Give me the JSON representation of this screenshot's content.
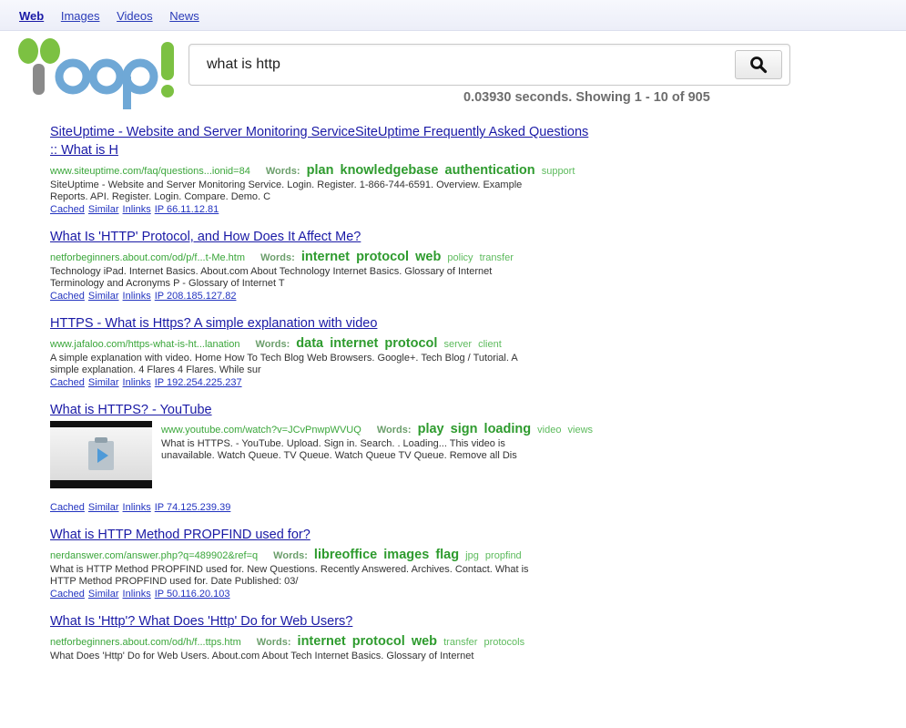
{
  "nav": {
    "tabs": [
      "Web",
      "Images",
      "Videos",
      "News"
    ]
  },
  "search": {
    "query": "what is http",
    "placeholder": ""
  },
  "stats": "0.03930 seconds. Showing 1 - 10 of 905",
  "link_labels": {
    "cached": "Cached",
    "similar": "Similar",
    "inlinks": "Inlinks"
  },
  "words_label": "Words:",
  "colors": {
    "link": "#1a1aa6",
    "url": "#3aa63a",
    "logo_blue": "#6fa8d6",
    "logo_green": "#7cc142"
  },
  "results": [
    {
      "title_lines": [
        "SiteUptime - Website and Server Monitoring ServiceSiteUptime Frequently Asked Questions",
        ":: What is H"
      ],
      "url": "www.siteuptime.com/faq/questions...ionid=84",
      "keywords_strong": [
        "plan",
        "knowledgebase",
        "authentication"
      ],
      "keywords_weak": [
        "support"
      ],
      "snippet_lines": [
        "SiteUptime - Website and Server Monitoring Service. Login. Register. 1-866-744-6591. Overview. Example",
        "Reports. API. Register. Login. Compare. Demo. C"
      ],
      "ip": "IP 66.11.12.81"
    },
    {
      "title_lines": [
        "What Is 'HTTP' Protocol, and How Does It Affect Me?"
      ],
      "url": "netforbeginners.about.com/od/p/f...t-Me.htm",
      "keywords_strong": [
        "internet",
        "protocol",
        "web"
      ],
      "keywords_weak": [
        "policy",
        "transfer"
      ],
      "snippet_lines": [
        "Technology iPad. Internet Basics. About.com About Technology Internet Basics. Glossary of Internet",
        "Terminology and Acronyms P - Glossary of Internet T"
      ],
      "ip": "IP 208.185.127.82"
    },
    {
      "title_lines": [
        "HTTPS - What is Https? A simple explanation with video"
      ],
      "url": "www.jafaloo.com/https-what-is-ht...lanation",
      "keywords_strong": [
        "data",
        "internet",
        "protocol"
      ],
      "keywords_weak": [
        "server",
        "client"
      ],
      "snippet_lines": [
        "A simple explanation with video. Home How To Tech Blog Web Browsers. Google+. Tech Blog / Tutorial. A",
        "simple explanation. 4 Flares 4 Flares. While sur"
      ],
      "ip": "IP 192.254.225.237"
    },
    {
      "title_lines": [
        "What is HTTPS? - YouTube"
      ],
      "url": "www.youtube.com/watch?v=JCvPnwpWVUQ",
      "keywords_strong": [
        "play",
        "sign",
        "loading"
      ],
      "keywords_weak": [
        "video",
        "views"
      ],
      "snippet_lines": [
        "What is HTTPS. - YouTube. Upload. Sign in. Search. . Loading... This video is",
        "unavailable. Watch Queue. TV Queue. Watch Queue TV Queue. Remove all Dis"
      ],
      "ip": "IP 74.125.239.39"
    },
    {
      "title_lines": [
        "What is HTTP Method PROPFIND used for?"
      ],
      "url": "nerdanswer.com/answer.php?q=489902&ref=q",
      "keywords_strong": [
        "libreoffice",
        "images",
        "flag"
      ],
      "keywords_weak": [
        "jpg",
        "propfind"
      ],
      "snippet_lines": [
        "What is HTTP Method PROPFIND used for. New Questions. Recently Answered. Archives. Contact. What is",
        "HTTP Method PROPFIND used for. Date Published: 03/"
      ],
      "ip": "IP 50.116.20.103"
    },
    {
      "title_lines": [
        "What Is 'Http'? What Does 'Http' Do for Web Users?"
      ],
      "url": "netforbeginners.about.com/od/h/f...ttps.htm",
      "keywords_strong": [
        "internet",
        "protocol",
        "web"
      ],
      "keywords_weak": [
        "transfer",
        "protocols"
      ],
      "snippet_lines": [
        "What Does 'Http' Do for Web Users. About.com About Tech Internet Basics. Glossary of Internet"
      ],
      "ip": ""
    }
  ]
}
